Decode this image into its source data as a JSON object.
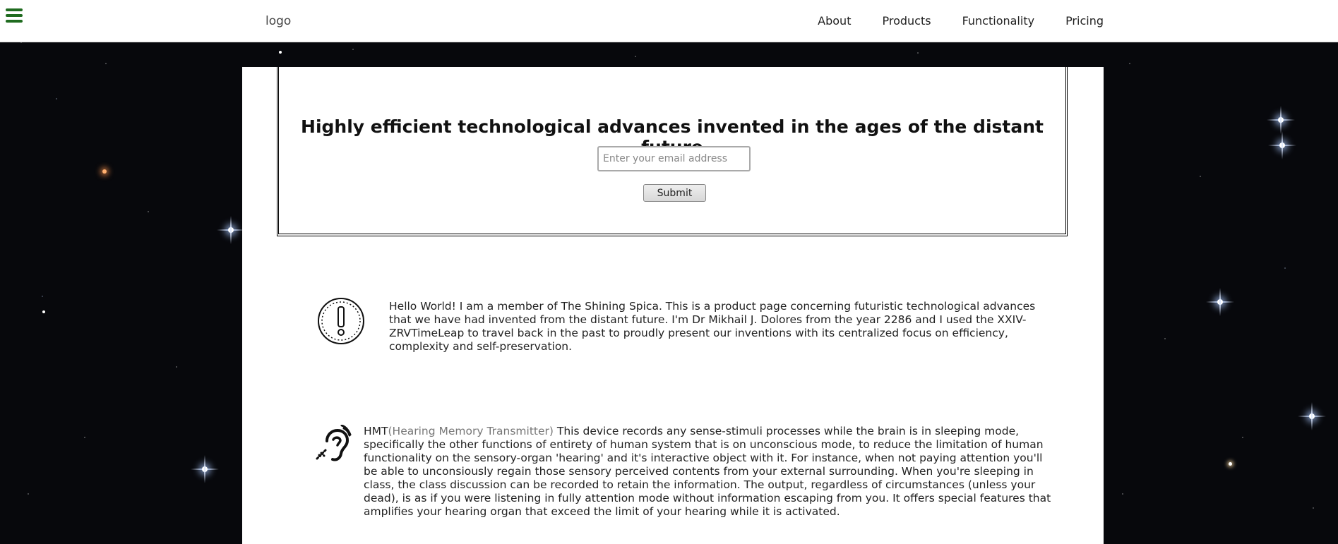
{
  "nav": {
    "logo": "logo",
    "links": [
      "About",
      "Products",
      "Functionality",
      "Pricing"
    ]
  },
  "hero": {
    "title": "Highly efficient technological advances invented in the ages of the distant future",
    "email_placeholder": "Enter your email address",
    "submit_label": "Submit"
  },
  "features": [
    {
      "icon": "exclamation-circle-icon",
      "text": "Hello World! I am a member of The Shining Spica. This is a product page concerning futuristic technological advances that we have had invented from the distant future. I'm Dr Mikhail J. Dolores from the year 2286 and I used the XXIV-ZRVTimeLeap to travel back in the past to proudly present our inventions with its centralized focus on efficiency, complexity and self-preservation."
    },
    {
      "icon": "hearing-assist-icon",
      "title": "HMT",
      "subtitle": "(Hearing Memory Transmitter)",
      "text": " This device records any sense-stimuli processes while the brain is in sleeping mode, specifically the other functions of entirety of human system that is on unconscious mode, to reduce the limitation of human functionality on the sensory-organ 'hearing' and it's interactive object with it. For instance, when not paying attention you'll be able to unconsiously regain those sensory perceived contents from your external surrounding. When you're sleeping in class, the class discussion can be recorded to retain the information. The output, regardless of circumstances (unless your dead), is as if you were listening in fully attention mode without information escaping from you. It offers special features that amplifies your hearing organ that exceed the limit of your hearing while it is activated."
    }
  ]
}
